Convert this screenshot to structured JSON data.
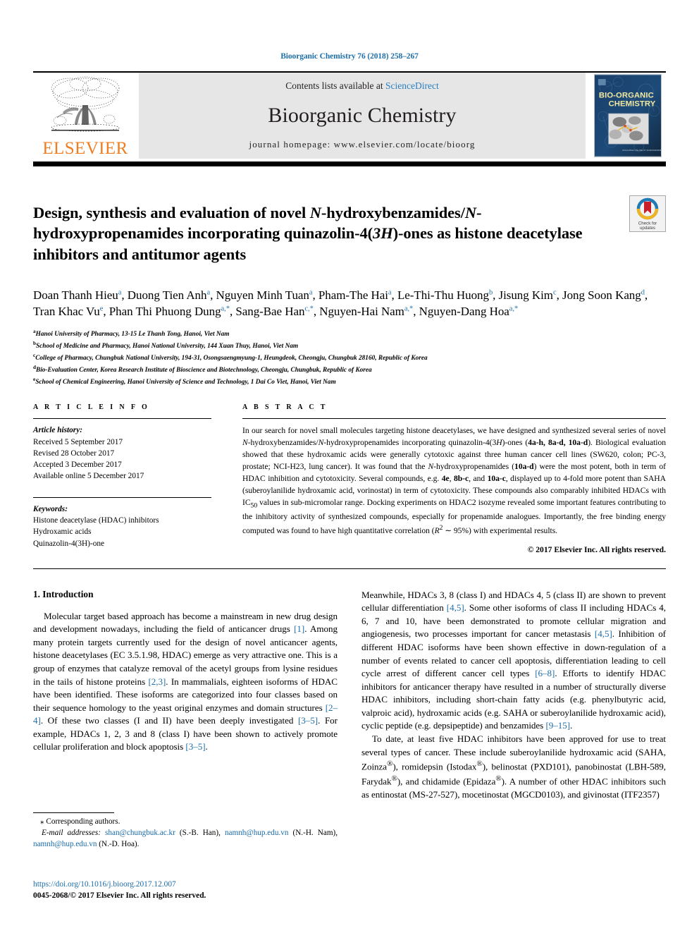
{
  "running_head": "Bioorganic Chemistry 76 (2018) 258–267",
  "masthead": {
    "publisher": "ELSEVIER",
    "contents_prefix": "Contents lists available at ",
    "sciencedirect": "ScienceDirect",
    "journal_name": "Bioorganic Chemistry",
    "homepage": "journal homepage: www.elsevier.com/locate/bioorg",
    "cover_line1": "BIO-ORGANIC",
    "cover_line2": "CHEMISTRY"
  },
  "crossmark": {
    "line1": "Check for",
    "line2": "updates"
  },
  "article": {
    "title_part1": "Design, synthesis and evaluation of novel ",
    "title_italic1": "N",
    "title_part2": "-hydroxybenzamides/",
    "title_italic2": "N",
    "title_part3": "-hydroxypropenamides incorporating quinazolin-4(",
    "title_italic3": "3H",
    "title_part4": ")-ones as histone deacetylase inhibitors and antitumor agents",
    "authors": [
      {
        "name": "Doan Thanh Hieu",
        "sup": "a",
        "sep": ", "
      },
      {
        "name": "Duong Tien Anh",
        "sup": "a",
        "sep": ", "
      },
      {
        "name": "Nguyen Minh Tuan",
        "sup": "a",
        "sep": ", "
      },
      {
        "name": "Pham-The Hai",
        "sup": "a",
        "sep": ", "
      },
      {
        "name": "Le-Thi-Thu Huong",
        "sup": "b",
        "sep": ", "
      },
      {
        "name": "Jisung Kim",
        "sup": "c",
        "sep": ", "
      },
      {
        "name": "Jong Soon Kang",
        "sup": "d",
        "sep": ", "
      },
      {
        "name": "Tran Khac Vu",
        "sup": "e",
        "sep": ", "
      },
      {
        "name": "Phan Thi Phuong Dung",
        "sup": "a,*",
        "sep": ", "
      },
      {
        "name": "Sang-Bae Han",
        "sup": "c,*",
        "sep": ", "
      },
      {
        "name": "Nguyen-Hai Nam",
        "sup": "a,*",
        "sep": ", "
      },
      {
        "name": "Nguyen-Dang Hoa",
        "sup": "a,*",
        "sep": ""
      }
    ],
    "affiliations": [
      {
        "marker": "a",
        "text": "Hanoi University of Pharmacy, 13-15 Le Thanh Tong, Hanoi, Viet Nam"
      },
      {
        "marker": "b",
        "text": "School of Medicine and Pharmacy, Hanoi National University, 144 Xuan Thuy, Hanoi, Viet Nam"
      },
      {
        "marker": "c",
        "text": "College of Pharmacy, Chungbuk National University, 194-31, Osongsaengmyung-1, Heungdeok, Cheongju, Chungbuk 28160, Republic of Korea"
      },
      {
        "marker": "d",
        "text": "Bio-Evaluation Center, Korea Research Institute of Bioscience and Biotechnology, Cheongju, Chungbuk, Republic of Korea"
      },
      {
        "marker": "e",
        "text": "School of Chemical Engineering, Hanoi University of Science and Technology, 1 Dai Co Viet, Hanoi, Viet Nam"
      }
    ]
  },
  "article_info": {
    "heading": "A R T I C L E   I N F O",
    "history_label": "Article history:",
    "history": [
      "Received 5 September 2017",
      "Revised 28 October 2017",
      "Accepted 3 December 2017",
      "Available online 5 December 2017"
    ],
    "keywords_label": "Keywords:",
    "keywords": [
      "Histone deacetylase (HDAC) inhibitors",
      "Hydroxamic acids",
      "Quinazolin-4(3H)-one"
    ]
  },
  "abstract": {
    "heading": "A B S T R A C T",
    "copyright": "© 2017 Elsevier Inc. All rights reserved."
  },
  "introduction": {
    "heading": "1. Introduction"
  },
  "footnotes": {
    "corresponding": "⁎ Corresponding authors.",
    "email_label": "E-mail addresses:",
    "email1": "shan@chungbuk.ac.kr",
    "email1_owner": "(S.-B. Han),",
    "email2": "namnh@hup.edu.vn",
    "email2_owner": "(N.-H. Nam),",
    "email3": "namnh@hup.edu.vn",
    "email3_owner": "(N.-D. Hoa)."
  },
  "footer": {
    "doi": "https://doi.org/10.1016/j.bioorg.2017.12.007",
    "issn": "0045-2068/© 2017 Elsevier Inc. All rights reserved."
  }
}
